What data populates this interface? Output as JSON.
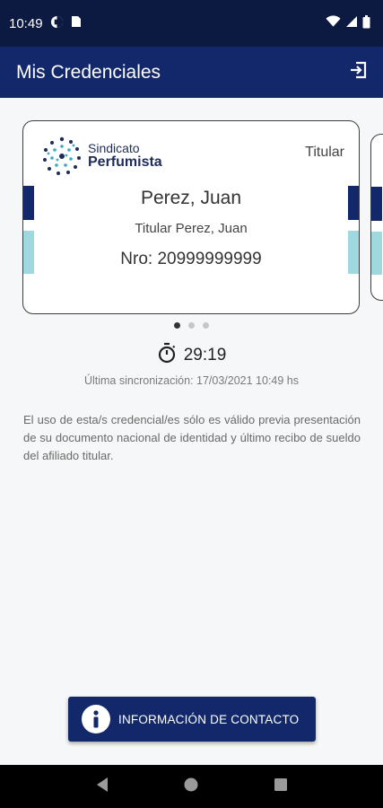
{
  "status_bar": {
    "time": "10:49",
    "icons": [
      "vpn-icon",
      "sim-icon",
      "wifi-icon",
      "signal-icon",
      "battery-icon"
    ]
  },
  "app_bar": {
    "title": "Mis Credenciales",
    "action_icon": "logout-icon"
  },
  "carousel": {
    "cards": [
      {
        "logo_line1": "Sindicato",
        "logo_line2": "Perfumista",
        "role": "Titular",
        "name": "Perez, Juan",
        "subtitle": "Titular Perez, Juan",
        "number": "Nro: 20999999999"
      }
    ],
    "page_count": 3,
    "active_page": 1
  },
  "timer": {
    "icon": "stopwatch-icon",
    "value": "29:19"
  },
  "sync_text": "Última sincronización: 17/03/2021 10:49 hs",
  "disclaimer": "El uso de esta/s credencial/es sólo es válido previa presentación de su documento nacional de identidad y último recibo de sueldo del afiliado titular.",
  "contact_button": {
    "icon": "info-icon",
    "label": "INFORMACIÓN DE CONTACTO"
  },
  "nav_bar": {
    "buttons": [
      "back-icon",
      "home-icon",
      "recents-icon"
    ]
  },
  "colors": {
    "status_bar": "#0c1a41",
    "primary": "#13286b",
    "accent_light": "#9fd8df",
    "background": "#f6f7f8"
  }
}
